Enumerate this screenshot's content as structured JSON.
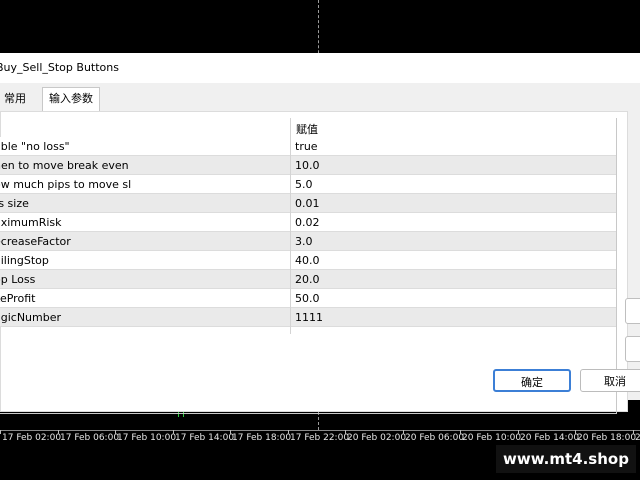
{
  "window": {
    "title": "Buy_Sell_Stop Buttons"
  },
  "tabs": [
    {
      "label": "常用",
      "active": false
    },
    {
      "label": "输入参数",
      "active": true
    }
  ],
  "table": {
    "header_value": "赋值",
    "rows": [
      {
        "name": "able \"no loss\"",
        "value": "true"
      },
      {
        "name": "hen to move break even",
        "value": "10.0"
      },
      {
        "name": "ow much pips to move sl",
        "value": "5.0"
      },
      {
        "name": "ts size",
        "value": "0.01"
      },
      {
        "name": "aximumRisk",
        "value": "0.02"
      },
      {
        "name": "ecreaseFactor",
        "value": "3.0"
      },
      {
        "name": "ailingStop",
        "value": "40.0"
      },
      {
        "name": "op Loss",
        "value": "20.0"
      },
      {
        "name": "keProfit",
        "value": "50.0"
      },
      {
        "name": "agicNumber",
        "value": "1111"
      }
    ]
  },
  "buttons": {
    "ok": "确定",
    "cancel": "取消"
  },
  "axis": {
    "labels": [
      "17 Feb 02:00",
      "17 Feb 06:00",
      "17 Feb 10:00",
      "17 Feb 14:00",
      "17 Feb 18:00",
      "17 Feb 22:00",
      "20 Feb 02:00",
      "20 Feb 06:00",
      "20 Feb 10:00",
      "20 Feb 14:00",
      "20 Feb 18:00",
      "20"
    ]
  },
  "watermark": "www.mt4.shop",
  "colors": {
    "ok_border": "#3c7fd6",
    "candle": "#2ecc40",
    "chart_bg": "#000000"
  }
}
